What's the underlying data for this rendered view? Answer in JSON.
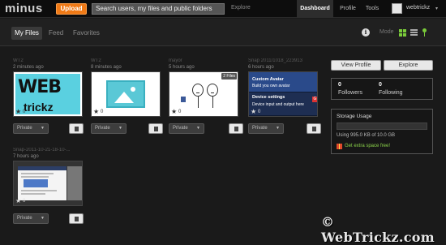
{
  "topbar": {
    "logo": "minus",
    "upload_label": "Upload",
    "search_placeholder": "Search users, my files and public folders",
    "explore_label": "Explore",
    "nav": {
      "dashboard": "Dashboard",
      "profile": "Profile",
      "tools": "Tools"
    },
    "username": "webtrickz",
    "caret": "▾"
  },
  "subbar": {
    "tabs": {
      "my_files": "My Files",
      "feed": "Feed",
      "favorites": "Favorites"
    },
    "info_glyph": "i",
    "mode_label": "Mode"
  },
  "cards": [
    {
      "title": "WT2",
      "time": "2 minutes ago",
      "stars": "0",
      "privacy": "Private",
      "thumb": "web-logo",
      "thumb_text1": "WEB",
      "thumb_text2": "trickz"
    },
    {
      "title": "WT2",
      "time": "8 minutes ago",
      "stars": "0",
      "privacy": "Private",
      "thumb": "image-placeholder-icon"
    },
    {
      "title": "mayor",
      "time": "5 hours ago",
      "stars": "0",
      "privacy": "Private",
      "thumb": "meme-comic",
      "badge": "2 Files"
    },
    {
      "title": "Snap 2011/1018_223913",
      "time": "6 hours ago",
      "stars": "0",
      "privacy": "Private",
      "thumb": "settings-screen",
      "screen_line1": "Custom Avatar",
      "screen_line2": "Build you own avatar",
      "screen_line3": "Device settings",
      "screen_line4": "Device input and output here",
      "g_badge": "G"
    },
    {
      "title": "Snap-2011-10-21-18-10-...",
      "time": "7 hours ago",
      "stars": "0",
      "privacy": "Private",
      "thumb": "browser-screenshot"
    }
  ],
  "right_panel": {
    "view_profile": "View Profile",
    "explore": "Explore",
    "followers_count": "0",
    "followers_label": "Followers",
    "following_count": "0",
    "following_label": "Following",
    "storage_title": "Storage Usage",
    "storage_text": "Using 995.0 KB of 10.0 GB",
    "storage_used_fraction": 0.0001,
    "extra_space": "Get extra space free!"
  },
  "watermark": "© WebTrickz.com",
  "colors": {
    "accent": "#f07a16",
    "green": "#7acb3a",
    "bg": "#1a1a1a"
  }
}
